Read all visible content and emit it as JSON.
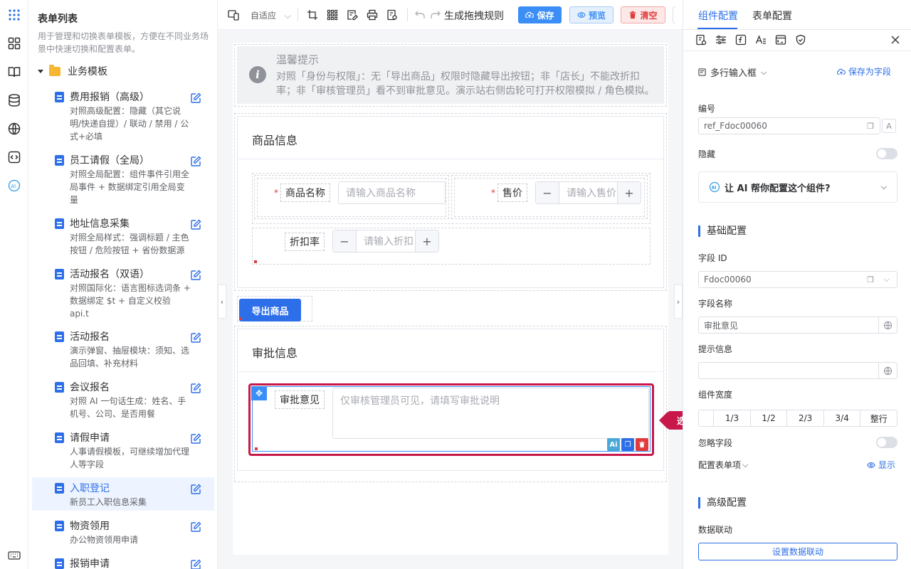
{
  "sidebar": {
    "title": "表单列表",
    "description": "用于管理和切换表单模板，方便在不同业务场景中快速切换和配置表单。",
    "folder": "业务模板",
    "items": [
      {
        "name": "费用报销（高级）",
        "sub": "对照高级配置：隐藏（其它说明/快递自提）/ 联动 / 禁用 / 公式+必填"
      },
      {
        "name": "员工请假（全局）",
        "sub": "对照全局配置：组件事件引用全局事件 + 数据绑定引用全局变量"
      },
      {
        "name": "地址信息采集",
        "sub": "对照全局样式：强调标题 / 主色按钮 / 危险按钮 + 省份数据源"
      },
      {
        "name": "活动报名（双语）",
        "sub": "对照国际化：语言图标选词条 + 数据绑定 $t + 自定义校验 api.t"
      },
      {
        "name": "活动报名",
        "sub": "演示弹窗、抽屉模块：须知、选品回填、补充材料"
      },
      {
        "name": "会议报名",
        "sub": "对照 AI 一句话生成：姓名、手机号、公司、是否用餐"
      },
      {
        "name": "请假申请",
        "sub": "人事请假模板，可继续增加代理人等字段"
      },
      {
        "name": "入职登记",
        "sub": "新员工入职信息采集"
      },
      {
        "name": "物资领用",
        "sub": "办公物资领用申请"
      },
      {
        "name": "报销申请",
        "sub": ""
      }
    ]
  },
  "toolbar": {
    "adaptive": "自适应",
    "gen_rules": "生成拖拽规则",
    "save": "保存",
    "preview": "预览",
    "clear": "清空"
  },
  "canvas": {
    "tip_title": "温馨提示",
    "tip_body": "对照「身份与权限」：无「导出商品」权限时隐藏导出按钮；非「店长」不能改折扣率；非「审核管理员」看不到审批意见。演示站右侧齿轮可打开权限模拟 / 角色模拟。",
    "goods_title": "商品信息",
    "goods_name_label": "商品名称",
    "goods_name_placeholder": "请输入商品名称",
    "price_label": "售价",
    "price_placeholder": "请输入售价",
    "discount_label": "折扣率",
    "discount_placeholder": "请输入折扣",
    "export_button": "导出商品",
    "approval_title": "审批信息",
    "approval_label": "审批意见",
    "approval_placeholder": "仅审核管理员可见，请填写审批说明",
    "callout": "选中审批意见"
  },
  "right_panel": {
    "tab_component": "组件配置",
    "tab_form": "表单配置",
    "component_type": "多行输入框",
    "save_as_field": "保存为字段",
    "id_label": "编号",
    "id_value": "ref_Fdoc00060",
    "hidden_label": "隐藏",
    "ai_prompt": "让 AI 帮你配置这个组件?",
    "basic_section": "基础配置",
    "field_id_label": "字段 ID",
    "field_id_value": "Fdoc00060",
    "field_name_label": "字段名称",
    "field_name_value": "审批意见",
    "hint_label": "提示信息",
    "hint_value": "",
    "width_label": "组件宽度",
    "width_options": [
      "1/3",
      "1/2",
      "2/3",
      "3/4",
      "整行"
    ],
    "ignore_label": "忽略字段",
    "config_items_label": "配置表单项",
    "show_label": "显示",
    "advanced_section": "高级配置",
    "linkage_label": "数据联动",
    "linkage_button": "设置数据联动"
  }
}
